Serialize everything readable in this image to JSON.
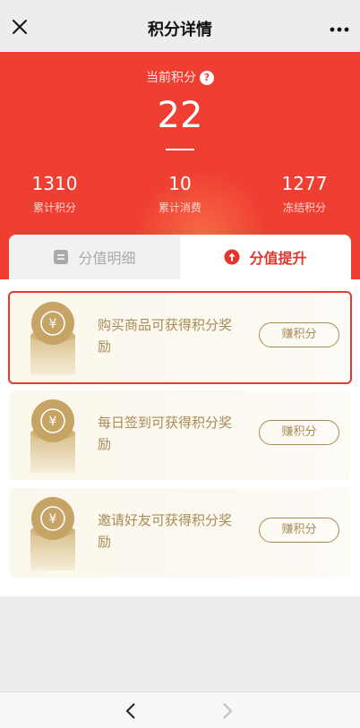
{
  "header": {
    "title": "积分详情",
    "close_icon": "close-icon",
    "more_icon": "more-icon"
  },
  "summary": {
    "label": "当前积分",
    "help_mark": "?",
    "points": "22",
    "stats": [
      {
        "value": "1310",
        "label": "累计积分"
      },
      {
        "value": "10",
        "label": "累计消费"
      },
      {
        "value": "1277",
        "label": "冻结积分"
      }
    ]
  },
  "tabs": [
    {
      "label": "分值明细",
      "icon": "list-icon",
      "active": false
    },
    {
      "label": "分值提升",
      "icon": "arrow-up-circle-icon",
      "active": true
    }
  ],
  "tasks": [
    {
      "text": "购买商品可获得积分奖励",
      "button": "赚积分",
      "selected": true
    },
    {
      "text": "每日签到可获得积分奖励",
      "button": "赚积分",
      "selected": false
    },
    {
      "text": "邀请好友可获得积分奖励",
      "button": "赚积分",
      "selected": false
    }
  ],
  "coin_symbol": "¥",
  "colors": {
    "brand_red": "#ef3e32",
    "gold_text": "#a88b55",
    "highlight_border": "#e53b32"
  },
  "bottom_nav": {
    "back_icon": "chevron-left-icon",
    "forward_icon": "chevron-right-icon"
  }
}
